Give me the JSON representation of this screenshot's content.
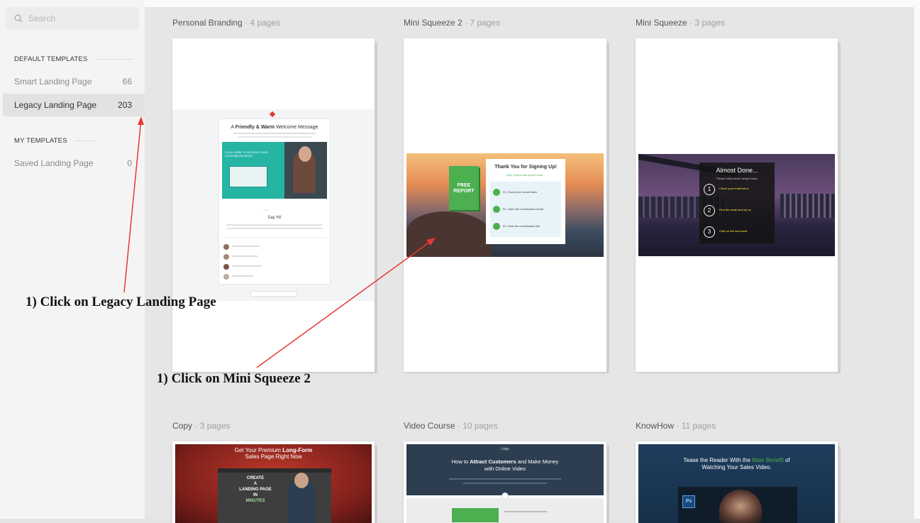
{
  "sidebar": {
    "search_placeholder": "Search",
    "default_header": "DEFAULT TEMPLATES",
    "my_header": "MY TEMPLATES",
    "items": [
      {
        "label": "Smart Landing Page",
        "count": "66"
      },
      {
        "label": "Legacy Landing Page",
        "count": "203"
      },
      {
        "label": "Saved Landing Page",
        "count": "0"
      }
    ]
  },
  "templates": [
    {
      "name": "Personal Branding",
      "pages": "4 pages",
      "preview": {
        "heading_a": "A ",
        "heading_b": "Friendly & Warm",
        "heading_c": " Welcome Message",
        "video_caption": "CLICK HERE TO ACCESS YOUR CUSTOMIZED BOOK",
        "sign": "Say Hi!"
      }
    },
    {
      "name": "Mini Squeeze 2",
      "pages": "7 pages",
      "preview": {
        "heading": "Thank You for Signing Up!",
        "sub": "Only 3 steps and you're done...",
        "book": "FREE REPORT",
        "steps": [
          "01. Check your email inbox",
          "02. Open the confirmation email",
          "03. Click the confirmation link"
        ]
      }
    },
    {
      "name": "Mini Squeeze",
      "pages": "3 pages",
      "preview": {
        "heading": "Almost Done...",
        "sub": "Please follow these simple steps",
        "steps": [
          "Check your email inbox",
          "Find the email sent by us",
          "Click on the link inside"
        ]
      }
    },
    {
      "name": "Copy",
      "pages": "3 pages",
      "preview": {
        "heading_a": "Get Your Premium ",
        "heading_b": "Long-Form",
        "heading_c": "Sales Page Right Now",
        "video_lines": [
          "CREATE",
          "A",
          "LANDING PAGE",
          "IN",
          "MINUTES"
        ]
      }
    },
    {
      "name": "Video Course",
      "pages": "10 pages",
      "preview": {
        "logo": "Logo",
        "heading_a": "How to ",
        "heading_b": "Attract Customers",
        "heading_c": " and Make Money",
        "heading_d": "with Online Video"
      }
    },
    {
      "name": "KnowHow",
      "pages": "11 pages",
      "preview": {
        "heading_a": "Tease the Reader With the ",
        "heading_b": "Main Benefit",
        "heading_c": " of",
        "heading_d": "Watching Your Sales Video.",
        "badge": "Ps"
      }
    }
  ],
  "annotations": {
    "legacy": "1) Click on Legacy Landing Page",
    "mini": "1) Click on Mini Squeeze 2"
  },
  "colors": {
    "accent_red": "#e53935",
    "teal": "#26b5a5",
    "green": "#4caf50"
  }
}
